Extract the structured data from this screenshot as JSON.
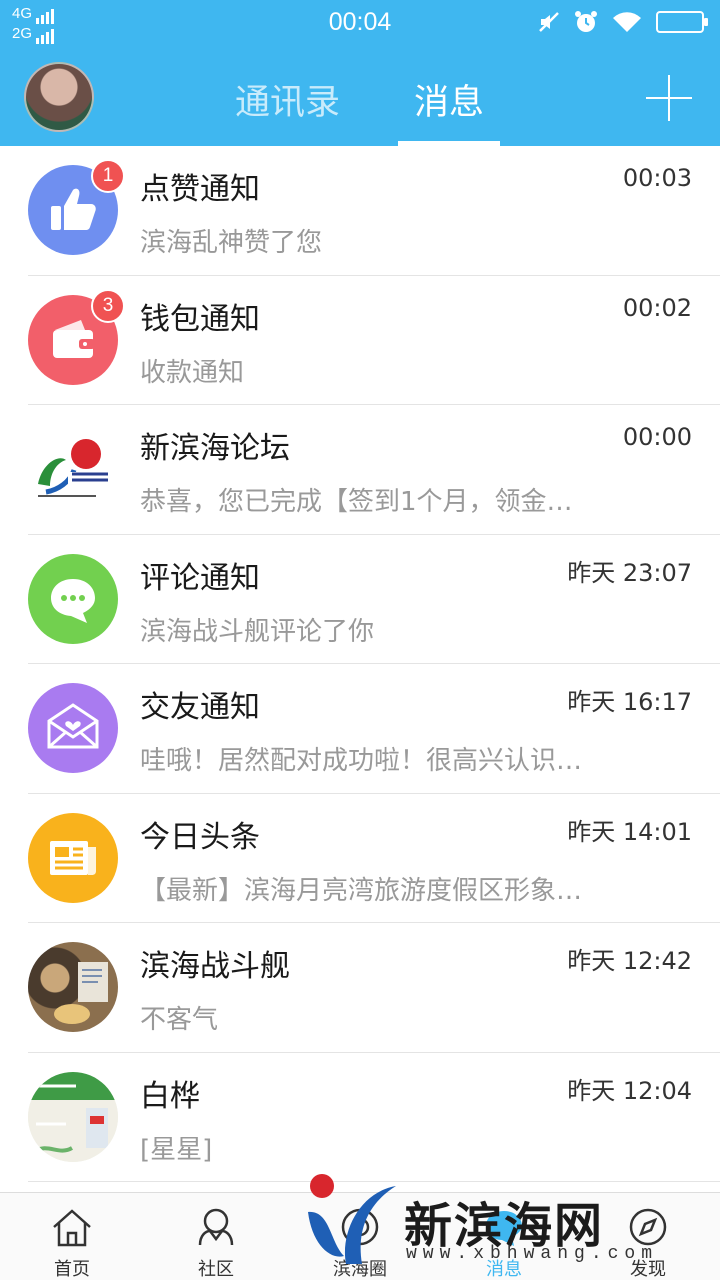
{
  "status_bar": {
    "network_top": "4G",
    "network_bottom": "2G",
    "time": "00:04",
    "icons": [
      "mute-icon",
      "alarm-icon",
      "wifi-icon",
      "battery-icon"
    ]
  },
  "header": {
    "tabs": [
      {
        "label": "通讯录",
        "active": false
      },
      {
        "label": "消息",
        "active": true
      }
    ],
    "add_icon": "plus-icon",
    "accent": "#3fb7f0"
  },
  "messages": [
    {
      "name": "点赞通知",
      "time": "00:03",
      "preview": "滨海乱神赞了您",
      "badge": "1",
      "icon": "thumbs-up-icon",
      "color": "#6f8ff0"
    },
    {
      "name": "钱包通知",
      "time": "00:02",
      "preview": "收款通知",
      "badge": "3",
      "icon": "wallet-icon",
      "color": "#f25f6a"
    },
    {
      "name": "新滨海论坛",
      "time": "00:00",
      "preview": "恭喜，您已完成【签到1个月，领金…",
      "icon": "xbh-logo",
      "color": "#ffffff"
    },
    {
      "name": "评论通知",
      "time": "昨天 23:07",
      "preview": "滨海战斗舰评论了你",
      "icon": "chat-bubble-icon",
      "color": "#72d04f"
    },
    {
      "name": "交友通知",
      "time": "昨天 16:17",
      "preview": "哇哦！居然配对成功啦！很高兴认识…",
      "icon": "envelope-heart-icon",
      "color": "#a97bf0"
    },
    {
      "name": "今日头条",
      "time": "昨天 14:01",
      "preview": "【最新】滨海月亮湾旅游度假区形象…",
      "icon": "newspaper-icon",
      "color": "#f9b21c"
    },
    {
      "name": "滨海战斗舰",
      "time": "昨天 12:42",
      "preview": "不客气",
      "icon": "user-photo",
      "color": "#6b5a45"
    },
    {
      "name": "白桦",
      "time": "昨天 12:04",
      "preview": "[星星]",
      "icon": "user-photo",
      "color": "#cfe9c9"
    }
  ],
  "bottom_nav": [
    {
      "label": "首页",
      "icon": "home-icon",
      "active": false
    },
    {
      "label": "社区",
      "icon": "community-icon",
      "active": false
    },
    {
      "label": "滨海圈",
      "icon": "circle-icon",
      "active": false
    },
    {
      "label": "消息",
      "icon": "message-icon",
      "active": true
    },
    {
      "label": "发现",
      "icon": "discover-icon",
      "active": false
    }
  ],
  "watermark": {
    "title": "新滨海网",
    "url": "www.xbhwang.com"
  }
}
